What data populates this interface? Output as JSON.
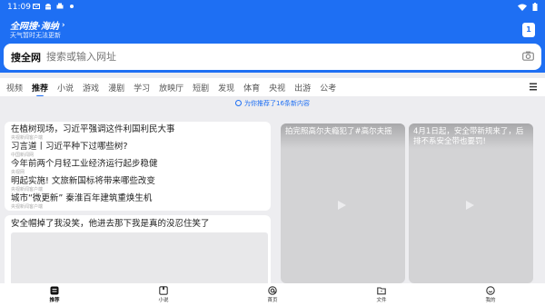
{
  "status_bar": {
    "time": "11:09"
  },
  "header": {
    "brand": "全网搜·海纳",
    "weather_text": "天气暂时无法更新",
    "tab_count": "1"
  },
  "search": {
    "brand_label": "搜全网",
    "placeholder": "搜索或输入网址"
  },
  "tabs": [
    "视频",
    "推荐",
    "小说",
    "游戏",
    "漫剧",
    "学习",
    "放映厅",
    "短剧",
    "发现",
    "体育",
    "央视",
    "出游",
    "公考"
  ],
  "active_tab": "推荐",
  "notice": "为你推荐了16条新内容",
  "news_list": [
    {
      "title": "在植树现场，习近平强调这件利国利民大事",
      "source": "央视新闻客户端"
    },
    {
      "title": "习言道丨习近平种下过哪些树?",
      "source": "中国新闻网"
    },
    {
      "title": "今年前两个月轻工业经济运行起步稳健",
      "source": "央视网"
    },
    {
      "title": "明起实施! 文旅新国标将带来哪些改变",
      "source": "央视新闻客户端"
    },
    {
      "title": "城市“微更新” 秦淮百年建筑重焕生机",
      "source": "央视新闻客户端"
    }
  ],
  "feature_card": {
    "title": "安全帽掉了我没笑，他进去那下我是真的没忍住笑了"
  },
  "videos": [
    {
      "caption": "拍完照高尔夫瘾犯了#高尔夫摇"
    },
    {
      "caption": "4月1日起，安全带新规来了，后排不系安全带也要罚!"
    }
  ],
  "bottom_nav": [
    {
      "label": "推荐",
      "icon": "recommend-icon"
    },
    {
      "label": "小说",
      "icon": "book-icon"
    },
    {
      "label": "首页",
      "icon": "home-icon"
    },
    {
      "label": "文件",
      "icon": "folder-icon"
    },
    {
      "label": "我的",
      "icon": "profile-icon"
    }
  ],
  "colors": {
    "accent": "#1e6ff3",
    "background": "#ededf0"
  }
}
